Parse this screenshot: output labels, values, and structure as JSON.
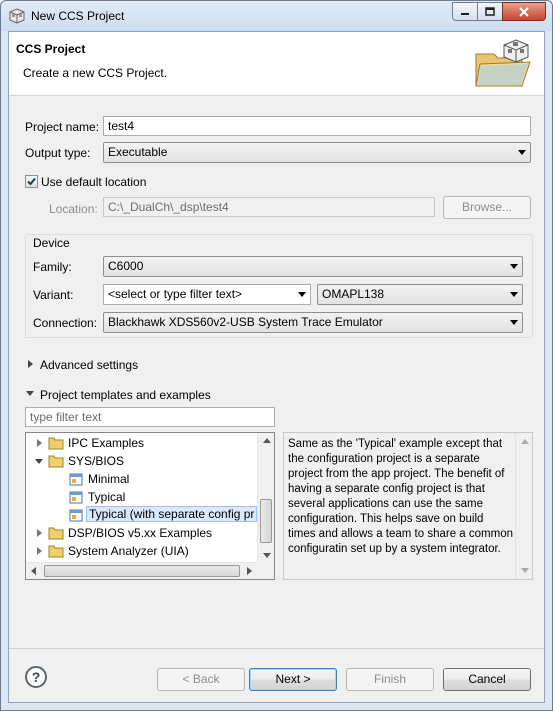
{
  "window": {
    "title": "New CCS Project",
    "controls": [
      "minimize",
      "maximize",
      "close"
    ]
  },
  "header": {
    "title": "CCS Project",
    "description": "Create a new CCS Project."
  },
  "project_name": {
    "label": "Project name:",
    "value": "test4"
  },
  "output_type": {
    "label": "Output type:",
    "value": "Executable"
  },
  "use_default_location": {
    "label": "Use default location",
    "checked": true
  },
  "location": {
    "label": "Location:",
    "value": "C:\\_DualCh\\_dsp\\test4",
    "browse_label": "Browse..."
  },
  "device": {
    "group_label": "Device",
    "family": {
      "label": "Family:",
      "value": "C6000"
    },
    "variant": {
      "label": "Variant:",
      "filter_value": "<select or type filter text>",
      "value": "OMAPL138"
    },
    "connection": {
      "label": "Connection:",
      "value": "Blackhawk XDS560v2-USB System Trace Emulator"
    }
  },
  "advanced": {
    "label": "Advanced settings",
    "expanded": false
  },
  "templates": {
    "label": "Project templates and examples",
    "expanded": true,
    "filter_placeholder": "type filter text",
    "tree": [
      {
        "label": "IPC Examples",
        "level": 0,
        "expander": "closed"
      },
      {
        "label": "SYS/BIOS",
        "level": 0,
        "expander": "open"
      },
      {
        "label": "Minimal",
        "level": 1,
        "expander": "none"
      },
      {
        "label": "Typical",
        "level": 1,
        "expander": "none"
      },
      {
        "label": "Typical (with separate config pr",
        "level": 1,
        "expander": "none",
        "selected": true
      },
      {
        "label": "DSP/BIOS v5.xx Examples",
        "level": 0,
        "expander": "closed"
      },
      {
        "label": "System Analyzer (UIA)",
        "level": 0,
        "expander": "closed"
      }
    ],
    "description": "Same as the 'Typical' example except that the configuration project is a separate project from the app project.  The benefit of having a separate config project is that several applications can use the same configuration.  This helps save on build times and allows a team to share a common configuratin set up by a system integrator."
  },
  "buttons": {
    "help": "?",
    "back": "< Back",
    "next": "Next >",
    "finish": "Finish",
    "cancel": "Cancel"
  }
}
